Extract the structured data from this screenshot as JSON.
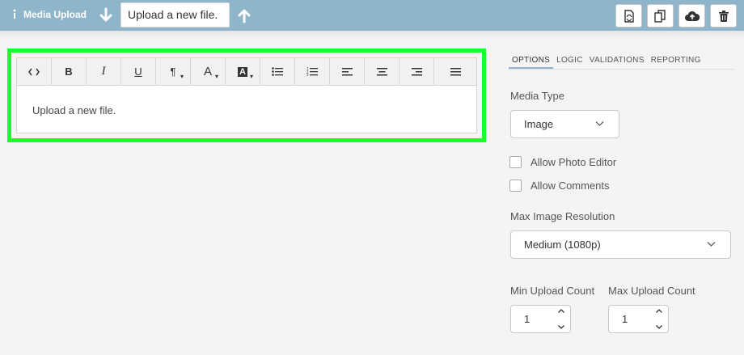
{
  "topbar": {
    "title": "Media Upload",
    "question_name": "Upload a new file."
  },
  "editor": {
    "content": "Upload a new file.",
    "toolbar": {
      "source": "<>",
      "bold": "B",
      "italic": "I",
      "underline": "U",
      "paragraph": "¶",
      "font_color": "A",
      "bg_color": "A"
    }
  },
  "panel": {
    "tabs": [
      "OPTIONS",
      "LOGIC",
      "VALIDATIONS",
      "REPORTING"
    ],
    "media_type_label": "Media Type",
    "media_type_value": "Image",
    "allow_photo_editor": "Allow Photo Editor",
    "allow_comments": "Allow Comments",
    "max_res_label": "Max Image Resolution",
    "max_res_value": "Medium (1080p)",
    "min_count_label": "Min Upload Count",
    "min_count_value": "1",
    "max_count_label": "Max Upload Count",
    "max_count_value": "1"
  },
  "colors": {
    "topbar": "#8eb5c9",
    "highlight": "#1aff2a"
  }
}
